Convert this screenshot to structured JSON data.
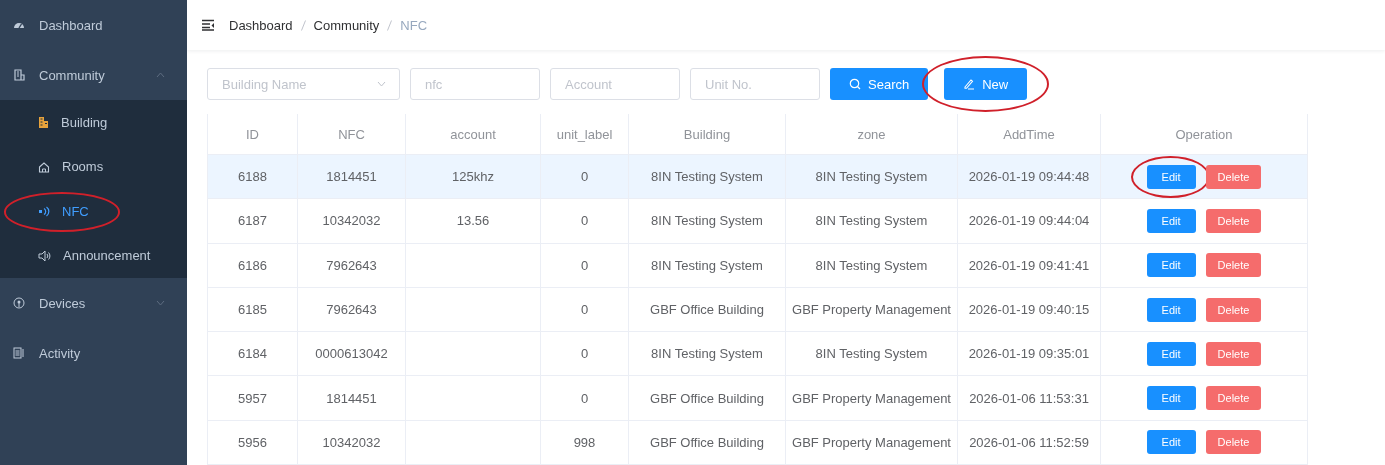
{
  "sidebar": {
    "items": [
      {
        "label": "Dashboard",
        "selected": false,
        "circled": false
      },
      {
        "label": "Community",
        "selected": false,
        "circled": false,
        "expanded": true,
        "children": [
          {
            "label": "Building",
            "selected": false,
            "circled": false
          },
          {
            "label": "Rooms",
            "selected": false,
            "circled": false
          },
          {
            "label": "NFC",
            "selected": true,
            "circled": true
          },
          {
            "label": "Announcement",
            "selected": false,
            "circled": false
          }
        ]
      },
      {
        "label": "Devices",
        "selected": false,
        "circled": false,
        "expanded": false
      },
      {
        "label": "Activity",
        "selected": false,
        "circled": false
      }
    ]
  },
  "breadcrumb": [
    "Dashboard",
    "Community",
    "NFC"
  ],
  "filters": [
    {
      "kind": "select",
      "placeholder": "Building Name"
    },
    {
      "kind": "input",
      "placeholder": "nfc"
    },
    {
      "kind": "input",
      "placeholder": "Account"
    },
    {
      "kind": "input",
      "placeholder": "Unit No."
    }
  ],
  "buttons": [
    {
      "kind": "search",
      "label": "Search",
      "circled": false
    },
    {
      "kind": "new",
      "label": "New",
      "circled": true
    }
  ],
  "table": {
    "columns": [
      "ID",
      "NFC",
      "account",
      "unit_label",
      "Building",
      "zone",
      "AddTime",
      "Operation"
    ],
    "rows": [
      {
        "selected": true,
        "cells": [
          "6188",
          "1814451",
          "125khz",
          "0",
          "8IN Testing System",
          "8IN Testing System",
          "2026-01-19 09:44:48"
        ],
        "actions": [
          {
            "kind": "edit",
            "label": "Edit",
            "circled": true
          },
          {
            "kind": "delete",
            "label": "Delete",
            "circled": false
          }
        ]
      },
      {
        "selected": false,
        "cells": [
          "6187",
          "10342032",
          "13.56",
          "0",
          "8IN Testing System",
          "8IN Testing System",
          "2026-01-19 09:44:04"
        ],
        "actions": [
          {
            "kind": "edit",
            "label": "Edit",
            "circled": false
          },
          {
            "kind": "delete",
            "label": "Delete",
            "circled": false
          }
        ]
      },
      {
        "selected": false,
        "cells": [
          "6186",
          "7962643",
          null,
          "0",
          "8IN Testing System",
          "8IN Testing System",
          "2026-01-19 09:41:41"
        ],
        "actions": [
          {
            "kind": "edit",
            "label": "Edit",
            "circled": false
          },
          {
            "kind": "delete",
            "label": "Delete",
            "circled": false
          }
        ]
      },
      {
        "selected": false,
        "cells": [
          "6185",
          "7962643",
          null,
          "0",
          "GBF Office Building",
          "GBF Property Management",
          "2026-01-19 09:40:15"
        ],
        "actions": [
          {
            "kind": "edit",
            "label": "Edit",
            "circled": false
          },
          {
            "kind": "delete",
            "label": "Delete",
            "circled": false
          }
        ]
      },
      {
        "selected": false,
        "cells": [
          "6184",
          "0000613042",
          null,
          "0",
          "8IN Testing System",
          "8IN Testing System",
          "2026-01-19 09:35:01"
        ],
        "actions": [
          {
            "kind": "edit",
            "label": "Edit",
            "circled": false
          },
          {
            "kind": "delete",
            "label": "Delete",
            "circled": false
          }
        ]
      },
      {
        "selected": false,
        "cells": [
          "5957",
          "1814451",
          null,
          "0",
          "GBF Office Building",
          "GBF Property Management",
          "2026-01-06 11:53:31"
        ],
        "actions": [
          {
            "kind": "edit",
            "label": "Edit",
            "circled": false
          },
          {
            "kind": "delete",
            "label": "Delete",
            "circled": false
          }
        ]
      },
      {
        "selected": false,
        "cells": [
          "5956",
          "10342032",
          null,
          "998",
          "GBF Office Building",
          "GBF Property Management",
          "2026-01-06 11:52:59"
        ],
        "actions": [
          {
            "kind": "edit",
            "label": "Edit",
            "circled": false
          },
          {
            "kind": "delete",
            "label": "Delete",
            "circled": false
          }
        ]
      }
    ]
  }
}
